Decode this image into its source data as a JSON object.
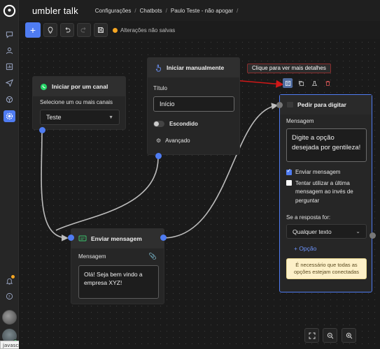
{
  "app": {
    "brand": "umbler talk"
  },
  "breadcrumb": [
    "Configurações",
    "Chatbots",
    "Paulo Teste - não apogar"
  ],
  "toolbar": {
    "status": "Alterações não salvas"
  },
  "tooltip": {
    "text": "Clique para ver mais detalhes"
  },
  "nodes": {
    "channel": {
      "title": "Iniciar por um canal",
      "field_label": "Selecione um ou mais canais",
      "select_value": "Teste"
    },
    "manual": {
      "title": "Iniciar manualmente",
      "title_label": "Título",
      "title_value": "Início",
      "hidden_label": "Escondido",
      "advanced_label": "Avançado"
    },
    "send": {
      "title": "Enviar mensagem",
      "message_label": "Mensagem",
      "message_text": "Olá! Seja bem vindo a empresa XYZ!"
    },
    "ask": {
      "title": "Pedir para digitar",
      "message_label": "Mensagem",
      "message_text": "Digite a opção desejada por gentileza!",
      "send_message_label": "Enviar mensagem",
      "send_message_checked": true,
      "use_last_label": "Tentar utilizar a última mensagem ao invés de perguntar",
      "use_last_checked": false,
      "if_answer_label": "Se a resposta for:",
      "answer_value": "Qualquer texto",
      "add_option_label": "+ Opção",
      "warning": "É necessário que todas as opções estejam conectadas"
    }
  },
  "statusbar": {
    "js_tooltip": "javascript:;"
  },
  "colors": {
    "accent": "#4f7cf2",
    "warning": "#f5a623",
    "annotation_red": "#d01818"
  }
}
